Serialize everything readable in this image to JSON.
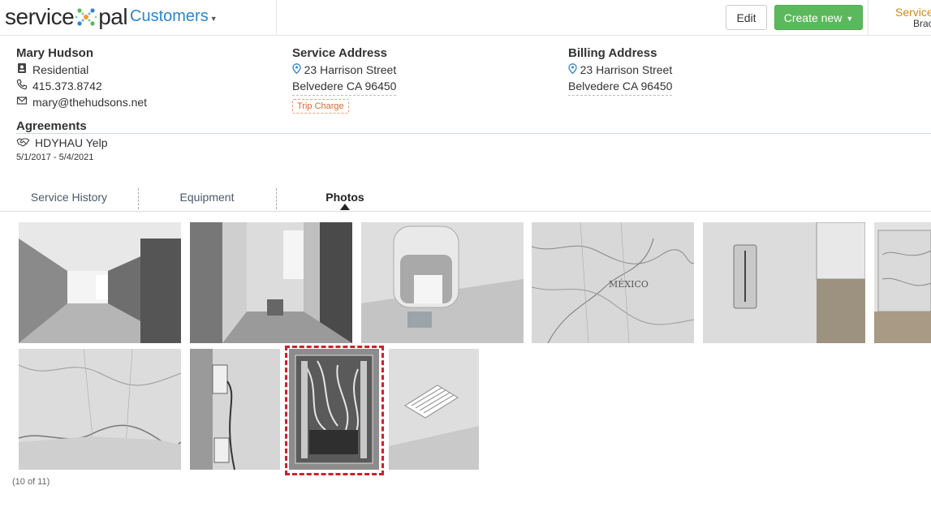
{
  "app": {
    "logo_left": "service",
    "logo_right": "pal",
    "module": "Customers",
    "edit_label": "Edit",
    "create_label": "Create new",
    "user_line1": "Service",
    "user_line2": "Brac"
  },
  "customer": {
    "name": "Mary Hudson",
    "type": "Residential",
    "phone": "415.373.8742",
    "email": "mary@thehudsons.net"
  },
  "service_address": {
    "heading": "Service Address",
    "line1": "23 Harrison Street",
    "line2": "Belvedere CA 96450",
    "tag": "Trip Charge"
  },
  "billing_address": {
    "heading": "Billing Address",
    "line1": "23 Harrison Street",
    "line2": "Belvedere CA 96450"
  },
  "agreements": {
    "heading": "Agreements",
    "name": "HDYHAU Yelp",
    "dates": "5/1/2017 - 5/4/2021"
  },
  "tabs": [
    {
      "label": "Service History",
      "active": false
    },
    {
      "label": "Equipment",
      "active": false
    },
    {
      "label": "Photos",
      "active": true
    }
  ],
  "photos": {
    "count_label": "(10 of 11)",
    "items": [
      {
        "subject": "hallway"
      },
      {
        "subject": "doorway"
      },
      {
        "subject": "coin jar"
      },
      {
        "subject": "map mexico"
      },
      {
        "subject": "thermostat"
      },
      {
        "subject": "map usa"
      },
      {
        "subject": "map gulf coast"
      },
      {
        "subject": "wall outlet"
      },
      {
        "subject": "electrical panel",
        "selected": true
      },
      {
        "subject": "ceiling vent"
      }
    ]
  }
}
